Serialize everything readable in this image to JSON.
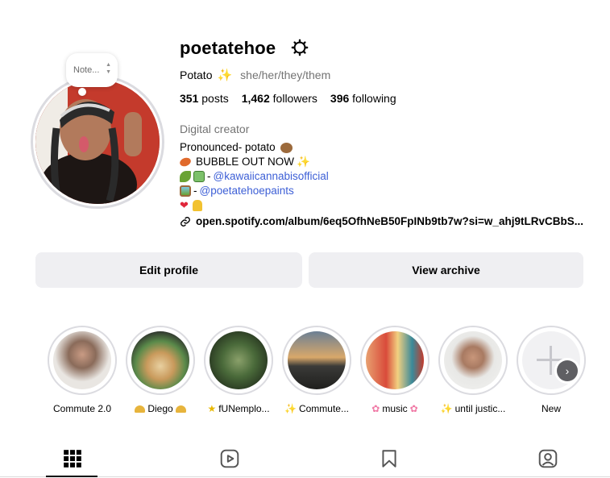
{
  "profile": {
    "username": "poetatehoe",
    "display_name": "Potato",
    "pronouns": "she/her/they/them",
    "note_placeholder": "Note...",
    "stats": {
      "posts_count": "351",
      "posts_label": "posts",
      "followers_count": "1,462",
      "followers_label": "followers",
      "following_count": "396",
      "following_label": "following"
    },
    "category": "Digital creator",
    "bio": {
      "line1": "Pronounced- potato",
      "line2": "BUBBLE OUT NOW",
      "line3_sep": "- ",
      "line3_link": "@kawaiicannabisofficial",
      "line4_sep": "-",
      "line4_link": "@poetatehoepaints"
    },
    "external_link": "open.spotify.com/album/6eq5OfhNeB50FpINb9tb7w?si=w_ahj9tLRvCBbS..."
  },
  "actions": {
    "edit_profile": "Edit profile",
    "view_archive": "View archive"
  },
  "highlights": [
    {
      "label": "Commute 2.0"
    },
    {
      "label": "Diego"
    },
    {
      "label": "fUNemplo..."
    },
    {
      "label": "Commute..."
    },
    {
      "label": "music"
    },
    {
      "label": "until justic..."
    },
    {
      "label": "New"
    }
  ],
  "tabs": [
    {
      "name": "posts",
      "icon": "grid-icon",
      "active": true
    },
    {
      "name": "reels",
      "icon": "reels-icon",
      "active": false
    },
    {
      "name": "saved",
      "icon": "bookmark-icon",
      "active": false
    },
    {
      "name": "tagged",
      "icon": "tagged-user-icon",
      "active": false
    }
  ],
  "colors": {
    "link": "#3d5fd6",
    "muted": "#737373",
    "button_bg": "#efeff2"
  }
}
